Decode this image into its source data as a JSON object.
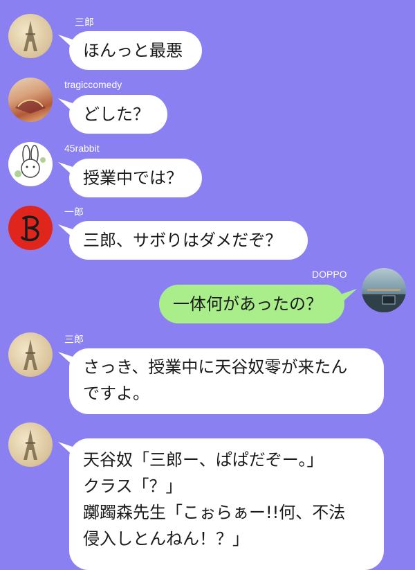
{
  "chat": {
    "messages": [
      {
        "name": "三郎",
        "text": "ほんっと最悪",
        "avatar": "eiffel-tower-avatar",
        "side": "left"
      },
      {
        "name": "tragiccomedy",
        "text": "どした？",
        "avatar": "folding-fan-avatar",
        "side": "left"
      },
      {
        "name": "45rabbit",
        "text": "授業中では？",
        "avatar": "rabbit-avatar",
        "side": "left"
      },
      {
        "name": "一郎",
        "text": "三郎、サボりはダメだぞ？",
        "avatar": "letter-b-avatar",
        "side": "left"
      },
      {
        "name": "DOPPO",
        "text": "一体何があったの？",
        "avatar": "sky-photo-avatar",
        "side": "right"
      },
      {
        "name": "三郎",
        "text": "さっき、授業中に天谷奴零が来たん\nですよ。",
        "avatar": "eiffel-tower-avatar",
        "side": "left"
      },
      {
        "name": "",
        "text": "天谷奴「三郎ー、ぱぱだぞー。」\nクラス「？」\n躑躅森先生「こぉらぁー!!何、不法\n侵入しとんねん！？」",
        "avatar": "eiffel-tower-avatar",
        "side": "left"
      }
    ]
  },
  "colors": {
    "background": "#8a80f2",
    "incoming_bubble": "#ffffff",
    "outgoing_bubble": "#a9ee8a",
    "name_text": "#ffffff"
  }
}
